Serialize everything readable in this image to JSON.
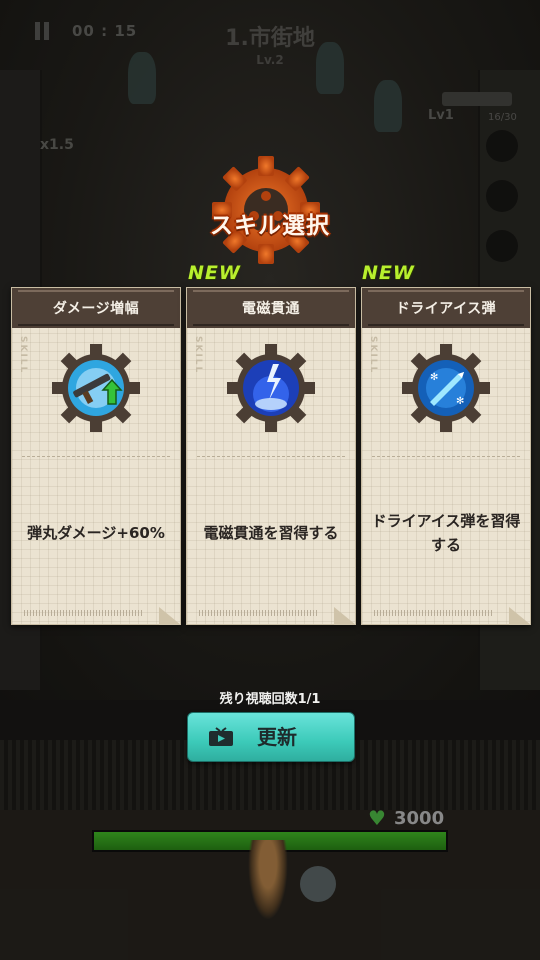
{
  "hud": {
    "timer": "00 : 15",
    "stage_name": "1.市街地",
    "stage_level": "Lv.2",
    "speed": "x1.5",
    "weapon": {
      "level": "Lv1",
      "ammo": "16/30"
    },
    "health": "3000"
  },
  "title": "スキル選択",
  "cards": [
    {
      "name": "ダメージ増幅",
      "description": "弾丸ダメージ+60%",
      "badge": "",
      "side_label": "SKILL",
      "icon": "rifle-upgrade-icon"
    },
    {
      "name": "電磁貫通",
      "description": "電磁貫通を習得する",
      "badge": "NEW",
      "side_label": "SKILL",
      "icon": "lightning-icon"
    },
    {
      "name": "ドライアイス弾",
      "description": "ドライアイス弾を習得する",
      "badge": "NEW",
      "side_label": "SKILL",
      "icon": "ice-bullet-icon"
    }
  ],
  "watch_count": "残り視聴回数1/1",
  "refresh_label": "更新",
  "colors": {
    "title_orange": "#e8671c",
    "new_badge": "#b8ef2e",
    "refresh_button": "#3ccab9",
    "card_bg": "#ebe3d1",
    "card_header": "#4e4036"
  }
}
